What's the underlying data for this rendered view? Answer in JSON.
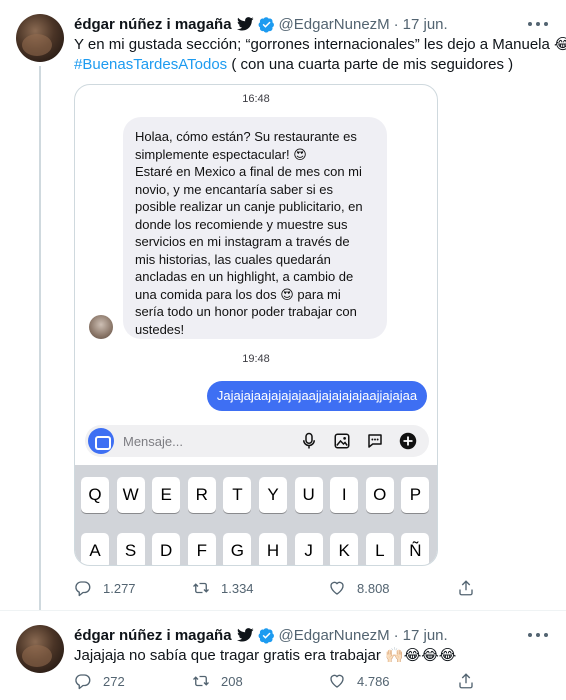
{
  "tweets": [
    {
      "author_name": "édgar núñez i magaña",
      "handle": "@EdgarNunezM",
      "separator": "·",
      "date": "17 jun.",
      "text_line1": "Y en mi gustada sección; “gorrones internacionales” les dejo a Manuela 😂",
      "hashtag": "#BuenasTardesATodos",
      "text_line2_rest": " ( con una cuarta parte de mis seguidores )",
      "media": {
        "time_top": "16:48",
        "incoming_lines": [
          "Holaa, cómo están? Su restaurante es",
          "simplemente espectacular! 😍",
          "Estaré en Mexico a final de mes con mi",
          "novio, y me encantaría saber si es",
          "posible realizar un canje publicitario, en",
          "donde los recomiende y muestre sus",
          "servicios en mi instagram a través de",
          "mis historias, las cuales quedarán",
          "ancladas en un highlight, a cambio de",
          "una comida para los dos 😍 para mi",
          "sería todo un honor poder trabajar con",
          "ustedes!"
        ],
        "time_mid": "19:48",
        "outgoing": "Jajajajaajajajajaajjajajajajaajjajajaa",
        "composer_placeholder": "Mensaje...",
        "keyboard_row1": [
          "Q",
          "W",
          "E",
          "R",
          "T",
          "Y",
          "U",
          "I",
          "O",
          "P"
        ],
        "keyboard_row2": [
          "A",
          "S",
          "D",
          "F",
          "G",
          "H",
          "J",
          "K",
          "L",
          "Ñ"
        ]
      },
      "actions": {
        "replies": "1.277",
        "retweets": "1.334",
        "likes": "8.808"
      }
    },
    {
      "author_name": "édgar núñez i magaña",
      "handle": "@EdgarNunezM",
      "separator": "·",
      "date": "17 jun.",
      "text": "Jajajaja no sabía que tragar gratis era trabajar 🙌🏻😂😂😂",
      "actions": {
        "replies": "272",
        "retweets": "208",
        "likes": "4.786"
      }
    }
  ],
  "colors": {
    "accent": "#1d9bf0",
    "text_secondary": "#536471",
    "outgoing_bubble": "#3e6ff3",
    "incoming_bubble": "#efeff4"
  },
  "icons": [
    "twitter-bird-icon",
    "verified-badge-icon",
    "more-icon",
    "reply-icon",
    "retweet-icon",
    "like-icon",
    "share-icon",
    "camera-icon",
    "microphone-icon",
    "gallery-icon",
    "sticker-icon",
    "plus-icon"
  ]
}
